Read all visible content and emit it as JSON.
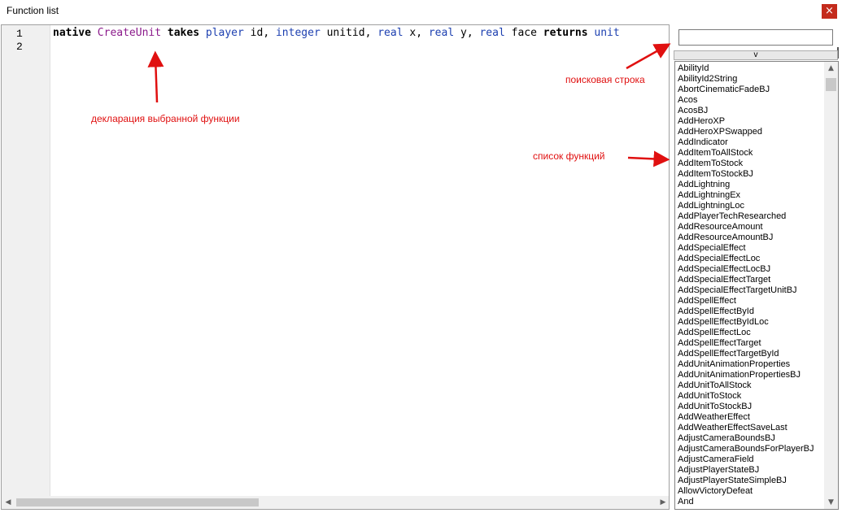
{
  "window": {
    "title": "Function list",
    "close_glyph": "×"
  },
  "editor": {
    "line_numbers": [
      "1",
      "2"
    ],
    "code": {
      "kw_native": "native",
      "fn_name": "CreateUnit",
      "kw_takes": "takes",
      "type_player": "player",
      "arg_id": "id,",
      "type_integer": "integer",
      "arg_unitid": "unitid,",
      "type_real1": "real",
      "arg_x": "x,",
      "type_real2": "real",
      "arg_y": "y,",
      "type_real3": "real",
      "arg_face": "face",
      "kw_returns": "returns",
      "type_unit": "unit"
    }
  },
  "search": {
    "value": "",
    "dropdown_label": "v"
  },
  "function_list": [
    "AbilityId",
    "AbilityId2String",
    "AbortCinematicFadeBJ",
    "Acos",
    "AcosBJ",
    "AddHeroXP",
    "AddHeroXPSwapped",
    "AddIndicator",
    "AddItemToAllStock",
    "AddItemToStock",
    "AddItemToStockBJ",
    "AddLightning",
    "AddLightningEx",
    "AddLightningLoc",
    "AddPlayerTechResearched",
    "AddResourceAmount",
    "AddResourceAmountBJ",
    "AddSpecialEffect",
    "AddSpecialEffectLoc",
    "AddSpecialEffectLocBJ",
    "AddSpecialEffectTarget",
    "AddSpecialEffectTargetUnitBJ",
    "AddSpellEffect",
    "AddSpellEffectById",
    "AddSpellEffectByIdLoc",
    "AddSpellEffectLoc",
    "AddSpellEffectTarget",
    "AddSpellEffectTargetById",
    "AddUnitAnimationProperties",
    "AddUnitAnimationPropertiesBJ",
    "AddUnitToAllStock",
    "AddUnitToStock",
    "AddUnitToStockBJ",
    "AddWeatherEffect",
    "AddWeatherEffectSaveLast",
    "AdjustCameraBoundsBJ",
    "AdjustCameraBoundsForPlayerBJ",
    "AdjustCameraField",
    "AdjustPlayerStateBJ",
    "AdjustPlayerStateSimpleBJ",
    "AllowVictoryDefeat",
    "And"
  ],
  "annotations": {
    "declaration": "декларация выбранной функции",
    "search_row": "поисковая строка",
    "function_list": "список функций"
  },
  "colors": {
    "annotation": "#e01010",
    "keyword_type": "#1c3fb0",
    "function_name": "#8b1a8b",
    "close_button": "#c42b1c"
  }
}
